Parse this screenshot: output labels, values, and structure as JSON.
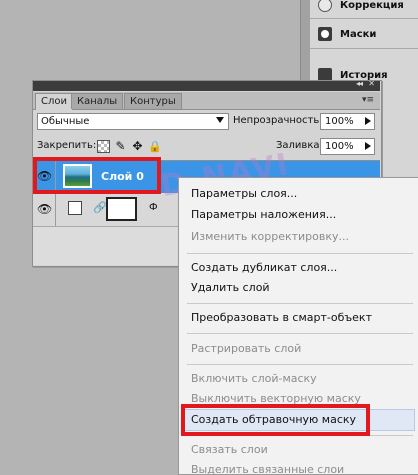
{
  "dock": {
    "items": [
      {
        "label": "Коррекция",
        "icon": "adjustments-icon"
      },
      {
        "label": "Маски",
        "icon": "masks-icon"
      },
      {
        "label": "История",
        "icon": "history-icon"
      }
    ]
  },
  "panel": {
    "tabs": [
      "Слои",
      "Каналы",
      "Контуры"
    ],
    "active_tab": "Слои",
    "menu_glyph": "▾≡",
    "collapse_glyph": "◂◂",
    "close_glyph": "✕",
    "blend_mode": "Обычные",
    "opacity_label": "Непрозрачность:",
    "opacity_value": "100%",
    "lock_label": "Закрепить:",
    "fill_label": "Заливка:",
    "fill_value": "100%",
    "layers": [
      {
        "name": "Слой 0",
        "selected": true
      },
      {
        "name": "",
        "selected": false
      }
    ],
    "row2_tail": "Ф"
  },
  "context_menu": {
    "items": [
      {
        "label": "Параметры слоя...",
        "disabled": false
      },
      {
        "label": "Параметры наложения...",
        "disabled": false
      },
      {
        "label": "Изменить корректировку...",
        "disabled": true
      },
      {
        "label": "Создать дубликат слоя...",
        "disabled": false
      },
      {
        "label": "Удалить слой",
        "disabled": false
      },
      {
        "label": "Преобразовать в смарт-объект",
        "disabled": false
      },
      {
        "label": "Растрировать слой",
        "disabled": true
      },
      {
        "label": "Включить слой-маску",
        "disabled": true
      },
      {
        "label": "Выключить векторную маску",
        "disabled": true
      },
      {
        "label": "Создать обтравочную маску",
        "disabled": false
      },
      {
        "label": "Связать слои",
        "disabled": true
      },
      {
        "label": "Выделить связанные слои",
        "disabled": true
      }
    ]
  },
  "watermark": "D-NAVI",
  "colors": {
    "selection": "#3a95e6",
    "highlight_red": "#e1191f",
    "menu_bg": "#f2f2f2"
  }
}
